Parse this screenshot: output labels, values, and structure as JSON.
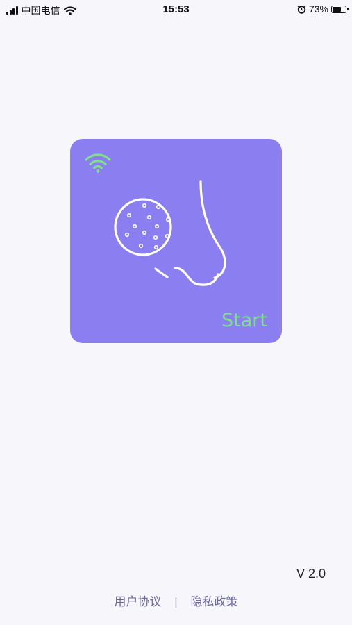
{
  "status_bar": {
    "carrier": "中国电信",
    "time": "15:53",
    "battery_percent": "73%",
    "battery_level": 0.73,
    "icons": [
      "signal-bars-icon",
      "wifi-icon",
      "alarm-icon",
      "battery-icon"
    ]
  },
  "card": {
    "start_label": "Start",
    "background_color": "#8a7ef0",
    "start_color": "#7fe08a",
    "icons": [
      "wifi-connected-icon",
      "pore-magnifier-icon",
      "nose-icon"
    ]
  },
  "version": "V 2.0",
  "footer": {
    "user_agreement": "用户协议",
    "separator": "|",
    "privacy_policy": "隐私政策"
  }
}
